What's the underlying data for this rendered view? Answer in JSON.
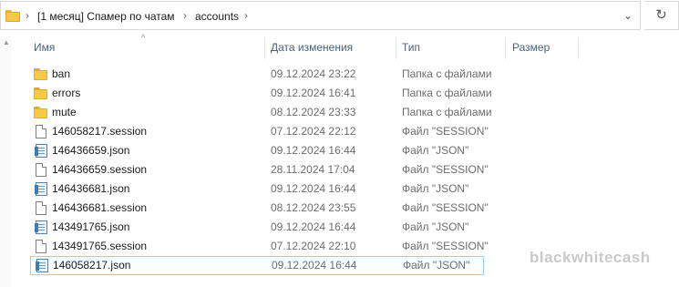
{
  "address": {
    "crumbs": [
      "[1 месяц] Спамер по чатам",
      "accounts"
    ],
    "separator": "›",
    "dropdown_icon": "chevron-down-icon",
    "refresh_icon": "refresh-icon",
    "refresh_glyph": "↻",
    "dropdown_glyph": "⌄"
  },
  "columns": {
    "name": "Имя",
    "date": "Дата изменения",
    "type": "Тип",
    "size": "Размер",
    "sort_glyph": "^"
  },
  "files": [
    {
      "name": "ban",
      "date": "09.12.2024 23:22",
      "type": "Папка с файлами",
      "icon": "folder"
    },
    {
      "name": "errors",
      "date": "09.12.2024 16:41",
      "type": "Папка с файлами",
      "icon": "folder"
    },
    {
      "name": "mute",
      "date": "08.12.2024 23:33",
      "type": "Папка с файлами",
      "icon": "folder"
    },
    {
      "name": "146058217.session",
      "date": "07.12.2024 22:12",
      "type": "Файл \"SESSION\"",
      "icon": "session"
    },
    {
      "name": "146436659.json",
      "date": "09.12.2024 16:44",
      "type": "Файл \"JSON\"",
      "icon": "json"
    },
    {
      "name": "146436659.session",
      "date": "28.11.2024 17:04",
      "type": "Файл \"SESSION\"",
      "icon": "session"
    },
    {
      "name": "146436681.json",
      "date": "09.12.2024 16:44",
      "type": "Файл \"JSON\"",
      "icon": "json"
    },
    {
      "name": "146436681.session",
      "date": "08.12.2024 23:55",
      "type": "Файл \"SESSION\"",
      "icon": "session"
    },
    {
      "name": "143491765.json",
      "date": "09.12.2024 16:44",
      "type": "Файл \"JSON\"",
      "icon": "json"
    },
    {
      "name": "143491765.session",
      "date": "07.12.2024 22:10",
      "type": "Файл \"SESSION\"",
      "icon": "session"
    },
    {
      "name": "146058217.json",
      "date": "09.12.2024 16:44",
      "type": "Файл \"JSON\"",
      "icon": "json",
      "selected": true
    }
  ],
  "watermark": "blackwhitecash",
  "colors": {
    "folder": "#f7c948",
    "header_text": "#4c607a",
    "selection_border": "#99d1ff",
    "secondary_text": "#6d6d6d"
  }
}
